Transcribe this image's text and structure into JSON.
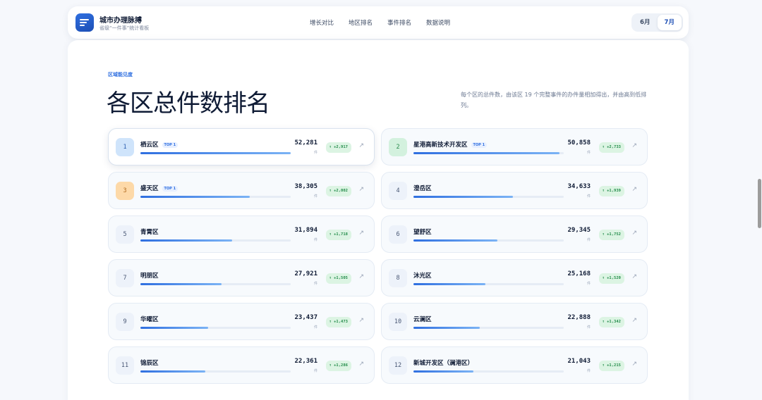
{
  "brand": {
    "title": "城市办理脉搏",
    "subtitle": "省级“一件事”统计看板"
  },
  "nav": [
    "增长对比",
    "地区排名",
    "事件排名",
    "数据说明"
  ],
  "months": [
    {
      "label": "6月",
      "active": false
    },
    {
      "label": "7月",
      "active": true
    }
  ],
  "section": {
    "eyebrow": "区域能见度",
    "title": "各区总件数排名",
    "description": "每个区的总件数，由该区 19 个完整事件的办件量相加得出，并由高到低排列。"
  },
  "unit_label": "件",
  "arrow_glyph": "↗",
  "districts": [
    {
      "rank": "1",
      "name": "栖云区",
      "badge": "TOP 1",
      "value": "52,281",
      "delta": "↑ +2,917",
      "share": 1.0
    },
    {
      "rank": "2",
      "name": "星港高新技术开发区",
      "badge": "TOP 1",
      "value": "50,858",
      "delta": "↑ +2,733",
      "share": 0.97
    },
    {
      "rank": "3",
      "name": "盛天区",
      "badge": "TOP 1",
      "value": "38,305",
      "delta": "↑ +2,002",
      "share": 0.73
    },
    {
      "rank": "4",
      "name": "澄岳区",
      "badge": "",
      "value": "34,633",
      "delta": "↑ +1,939",
      "share": 0.66
    },
    {
      "rank": "5",
      "name": "青霄区",
      "badge": "",
      "value": "31,894",
      "delta": "↑ +1,718",
      "share": 0.61
    },
    {
      "rank": "6",
      "name": "望舒区",
      "badge": "",
      "value": "29,345",
      "delta": "↑ +1,752",
      "share": 0.56
    },
    {
      "rank": "7",
      "name": "明朋区",
      "badge": "",
      "value": "27,921",
      "delta": "↑ +1,505",
      "share": 0.535
    },
    {
      "rank": "8",
      "name": "沐光区",
      "badge": "",
      "value": "25,168",
      "delta": "↑ +1,520",
      "share": 0.48
    },
    {
      "rank": "9",
      "name": "华曜区",
      "badge": "",
      "value": "23,437",
      "delta": "↑ +1,473",
      "share": 0.45
    },
    {
      "rank": "10",
      "name": "云澜区",
      "badge": "",
      "value": "22,888",
      "delta": "↑ +1,342",
      "share": 0.44
    },
    {
      "rank": "11",
      "name": "锦辰区",
      "badge": "",
      "value": "22,361",
      "delta": "↑ +1,286",
      "share": 0.43
    },
    {
      "rank": "12",
      "name": "新城开发区（澜港区）",
      "badge": "",
      "value": "21,043",
      "delta": "↑ +1,215",
      "share": 0.4
    }
  ]
}
